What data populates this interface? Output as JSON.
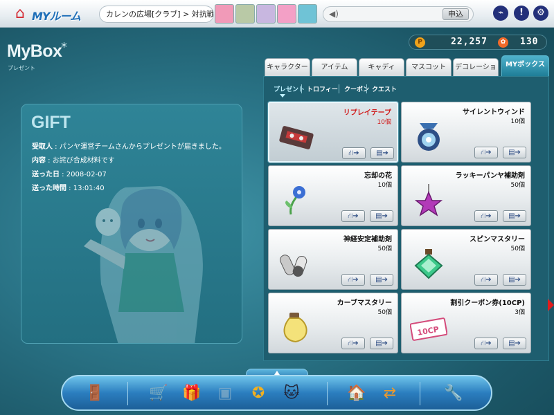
{
  "header": {
    "logo_text": "MYルーム",
    "breadcrumb": "カレンの広場[クラブ] > 対抗戦募集",
    "apply_label": "申込",
    "avatars": [
      {
        "color": "#f19ab8"
      },
      {
        "color": "#b9c9a6"
      },
      {
        "color": "#c8b7e0"
      },
      {
        "color": "#f3a0c6"
      },
      {
        "color": "#6fc3d6"
      }
    ]
  },
  "left": {
    "title": "MyBox",
    "title_star": "*",
    "subtitle": "プレゼント",
    "gift": {
      "title": "GIFT",
      "rows": [
        {
          "label": "受取人",
          "value": " : パンヤ運営チームさんからプレゼントが届きました。"
        },
        {
          "label": "内容",
          "value": " : お詫び合成材料です"
        },
        {
          "label": "送った日",
          "value": " : 2008-02-07"
        },
        {
          "label": "送った時間",
          "value": " : 13:01:40"
        }
      ]
    }
  },
  "currency": {
    "pang_icon": "P",
    "pang": "22,257",
    "cookie_icon": "✿",
    "cookie": "130"
  },
  "tabs": [
    {
      "label": "キャラクター"
    },
    {
      "label": "アイテム"
    },
    {
      "label": "キャディ"
    },
    {
      "label": "マスコット"
    },
    {
      "label": "デコレーション"
    },
    {
      "label": "MYボックス"
    }
  ],
  "subtabs": [
    {
      "label": "プレゼント"
    },
    {
      "label": "トロフィー"
    },
    {
      "label": "クーポン"
    },
    {
      "label": "クエスト"
    }
  ],
  "items": [
    {
      "name": "リプレイテープ",
      "qty": "10個"
    },
    {
      "name": "サイレントウィンド",
      "qty": "10個"
    },
    {
      "name": "忘却の花",
      "qty": "10個"
    },
    {
      "name": "ラッキーパンヤ補助剤",
      "qty": "50個"
    },
    {
      "name": "神経安定補助剤",
      "qty": "50個"
    },
    {
      "name": "スピンマスタリー",
      "qty": "50個"
    },
    {
      "name": "カーブマスタリー",
      "qty": "50個"
    },
    {
      "name": "割引クーポン券(10CP)",
      "qty": "3個"
    }
  ],
  "card_buttons": {
    "gift_label": "⛙➔",
    "send_label": "▤➔"
  },
  "item_icons": {
    "coupon_text": "10CP"
  },
  "dock": {
    "icons": [
      "exit-icon",
      "shop-icon",
      "gift-box-icon",
      "present-icon",
      "papel-icon",
      "cat-mascot-icon",
      "home-icon",
      "room-transfer-icon",
      "settings-icon"
    ]
  }
}
